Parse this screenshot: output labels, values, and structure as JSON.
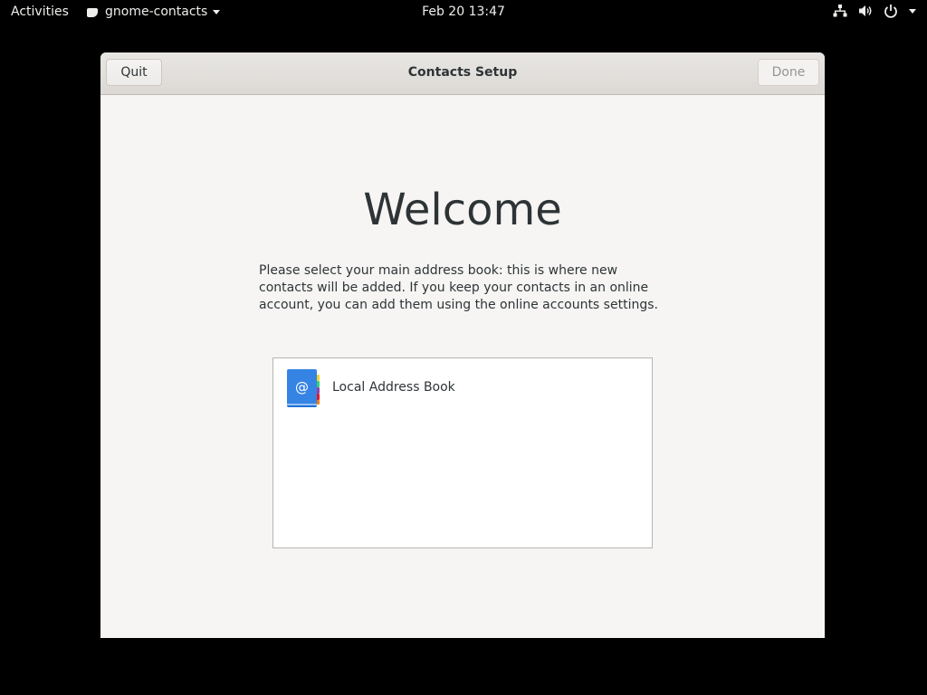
{
  "topbar": {
    "activities": "Activities",
    "app_name": "gnome-contacts",
    "clock": "Feb 20  13:47",
    "status_icons": [
      "network-wired-icon",
      "volume-icon",
      "power-icon",
      "chevron-down-icon"
    ]
  },
  "window": {
    "title": "Contacts Setup",
    "quit_label": "Quit",
    "done_label": "Done",
    "welcome": "Welcome",
    "description": "Please select your main address book: this is where new contacts will be added. If you keep your contacts in an online account, you can add them using the online accounts settings.",
    "address_books": [
      {
        "label": "Local Address Book",
        "icon": "address-book-icon"
      }
    ]
  },
  "colors": {
    "book_blue": "#3584e4",
    "window_bg": "#f6f5f4",
    "desktop_bg": "#000000"
  }
}
